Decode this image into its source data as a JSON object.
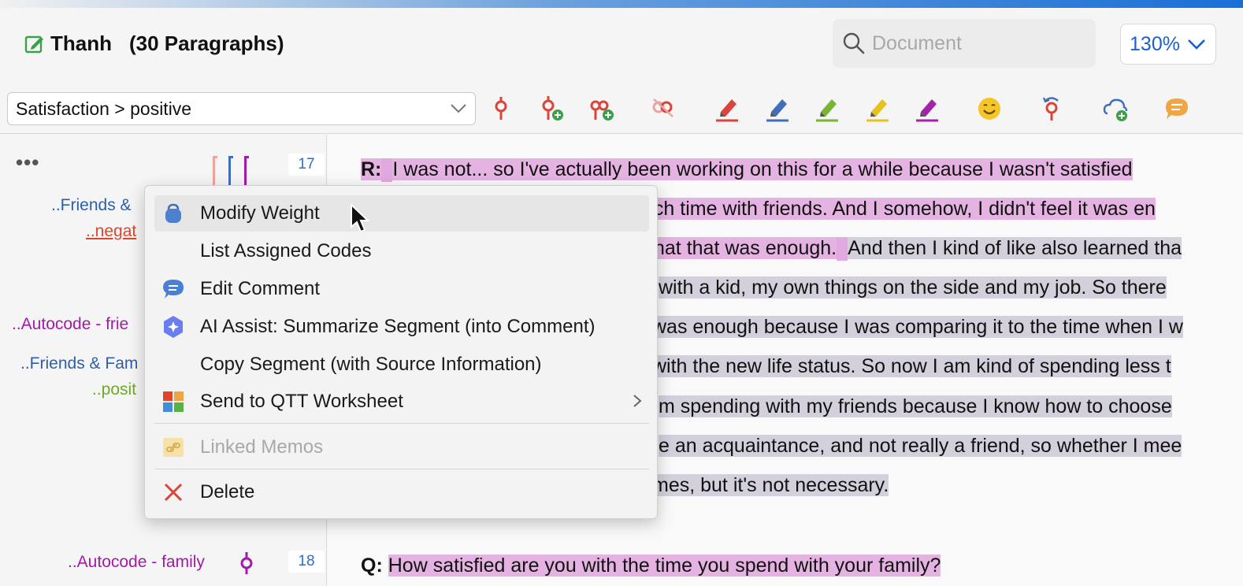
{
  "header": {
    "doc_name": "Thanh",
    "paragraphs": "(30 Paragraphs)",
    "search_placeholder": "Document",
    "zoom": "130%"
  },
  "toolbar": {
    "selected_code": "Satisfaction > positive",
    "tools": [
      "code-icon",
      "new-code-icon",
      "code-with-subcode-icon",
      "uncode-icon",
      "red-highlighter-icon",
      "blue-highlighter-icon",
      "green-highlighter-icon",
      "yellow-highlighter-icon",
      "magenta-highlighter-icon",
      "emoticon-code-icon",
      "undo-code-icon",
      "in-vivo-code-icon",
      "comment-icon"
    ],
    "colors": {
      "red": "#d9453a",
      "blue": "#3f6fb8",
      "green": "#79b530",
      "yellow": "#e7c21e",
      "magenta": "#a225a8",
      "orange": "#f0a443"
    }
  },
  "sidebar": {
    "more": "•••",
    "codes": [
      {
        "label": "..Friends &",
        "color": "#2d5fa8"
      },
      {
        "label": "..negat",
        "color": "#e0452c"
      },
      {
        "label": "..Autocode - frie",
        "color": "#a21aa8"
      },
      {
        "label": "..Friends & Fam",
        "color": "#2d5fa8"
      },
      {
        "label": "..posit",
        "color": "#6fa82a"
      },
      {
        "label": "..Autocode - family",
        "color": "#a21aa8"
      }
    ],
    "line_numbers": [
      "17",
      "18"
    ]
  },
  "document": {
    "speaker_r": "R:",
    "speaker_q": "Q:",
    "lines": [
      "I was not... so I've actually been working on this for a while because I wasn't satisfied",
      "uch time with friends. And I somehow, I didn't feel it was en",
      "hat that was enough.",
      "And then I kind of like also learned tha",
      "with a kid, my own things on the side and my job. So there",
      "was enough because I was comparing it to the time when I w",
      "with the new life status. So now I am kind of spending less t",
      "m spending with my friends because I know how to choose",
      "e an acquaintance, and not really a friend, so whether I mee",
      "mes, but it's not necessary."
    ],
    "question": "How satisfied are you with the time you spend with your family?"
  },
  "context_menu": {
    "items": [
      {
        "label": "Modify Weight",
        "icon": "weight-icon"
      },
      {
        "label": "List Assigned Codes",
        "icon": ""
      },
      {
        "label": "Edit Comment",
        "icon": "comment-icon"
      },
      {
        "label": "AI Assist: Summarize Segment (into Comment)",
        "icon": "ai-assist-icon"
      },
      {
        "label": "Copy Segment (with Source Information)",
        "icon": ""
      },
      {
        "label": "Send to QTT Worksheet",
        "icon": "qtt-worksheet-icon"
      },
      {
        "label": "Linked Memos",
        "icon": "linked-memo-icon"
      },
      {
        "label": "Delete",
        "icon": "delete-icon"
      }
    ]
  }
}
